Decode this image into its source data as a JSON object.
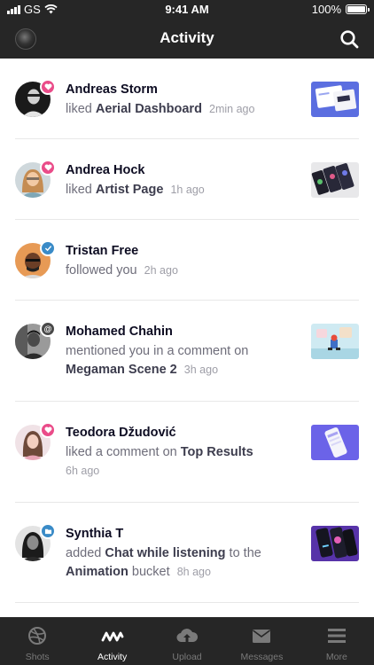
{
  "status_bar": {
    "carrier": "GS",
    "time": "9:41 AM",
    "battery": "100%"
  },
  "header": {
    "title": "Activity",
    "avatar_icon": "profile-avatar",
    "search_icon": "search-icon"
  },
  "feed": [
    {
      "name": "Andreas Storm",
      "action": "liked",
      "target": "Aerial Dashboard",
      "time": "2min ago",
      "badge": "heart"
    },
    {
      "name": "Andrea Hock",
      "action": "liked",
      "target": "Artist Page",
      "time": "1h ago",
      "badge": "heart"
    },
    {
      "name": "Tristan Free",
      "action": "followed you",
      "time": "2h ago",
      "badge": "check"
    },
    {
      "name": "Mohamed Chahin",
      "action": "mentioned you in a comment on",
      "target": "Megaman Scene 2",
      "time": "3h ago",
      "badge": "at",
      "badge_text": "@"
    },
    {
      "name": "Teodora Džudović",
      "action": "liked a comment on",
      "target": "Top Results",
      "time": "6h ago",
      "badge": "heart"
    },
    {
      "name": "Synthia T",
      "action": "added",
      "target": "Chat while listening",
      "action2": "to the",
      "target2": "Animation",
      "action3": "bucket",
      "time": "8h ago",
      "badge": "bucket"
    }
  ],
  "tabs": [
    {
      "label": "Shots",
      "icon": "dribbble-ball-icon",
      "active": false
    },
    {
      "label": "Activity",
      "icon": "activity-pulse-icon",
      "active": true
    },
    {
      "label": "Upload",
      "icon": "cloud-upload-icon",
      "active": false
    },
    {
      "label": "Messages",
      "icon": "envelope-icon",
      "active": false
    },
    {
      "label": "More",
      "icon": "menu-icon",
      "active": false
    }
  ],
  "colors": {
    "header_bg": "#262626",
    "heart": "#ea4c89",
    "blue": "#3a8bc7",
    "tab_inactive": "#7a7a7a",
    "tab_active": "#ffffff"
  }
}
